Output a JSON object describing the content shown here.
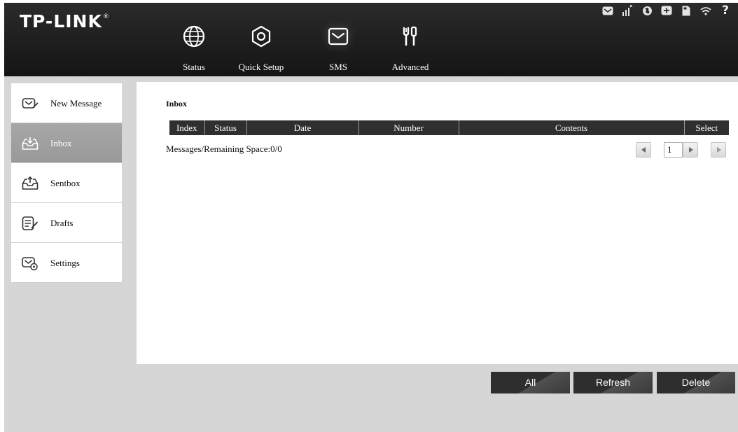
{
  "brand": {
    "logo_text": "TP-LINK",
    "registered_mark": "®"
  },
  "nav": {
    "items": [
      {
        "label": "Status",
        "icon": "globe-icon"
      },
      {
        "label": "Quick Setup",
        "icon": "setup-gear-icon"
      },
      {
        "label": "SMS",
        "icon": "envelope-icon",
        "active": true
      },
      {
        "label": "Advanced",
        "icon": "tools-icon"
      }
    ]
  },
  "status_bar": {
    "icons": [
      "sms-envelope-icon",
      "signal-strength-icon",
      "network-globe-icon",
      "connection-icon",
      "sim-card-icon",
      "wifi-icon",
      "help-icon"
    ],
    "help_label": "?"
  },
  "sidebar": {
    "items": [
      {
        "label": "New Message",
        "icon": "new-message-icon",
        "active": false
      },
      {
        "label": "Inbox",
        "icon": "inbox-icon",
        "active": true
      },
      {
        "label": "Sentbox",
        "icon": "sentbox-icon",
        "active": false
      },
      {
        "label": "Drafts",
        "icon": "drafts-icon",
        "active": false
      },
      {
        "label": "Settings",
        "icon": "sms-settings-icon",
        "active": false
      }
    ]
  },
  "main": {
    "title": "Inbox",
    "table": {
      "columns": [
        "Index",
        "Status",
        "Date",
        "Number",
        "Contents",
        "Select"
      ],
      "rows": []
    },
    "summary": "Messages/Remaining Space:0/0",
    "pager": {
      "page": "1"
    }
  },
  "actions": {
    "all_label": "All",
    "refresh_label": "Refresh",
    "delete_label": "Delete"
  },
  "colors": {
    "header_bg": "#1e1e1e",
    "active_sidebar_bg": "#a0a0a0",
    "button_bg": "#2e2e2e",
    "page_bg": "#d6d6d6"
  }
}
